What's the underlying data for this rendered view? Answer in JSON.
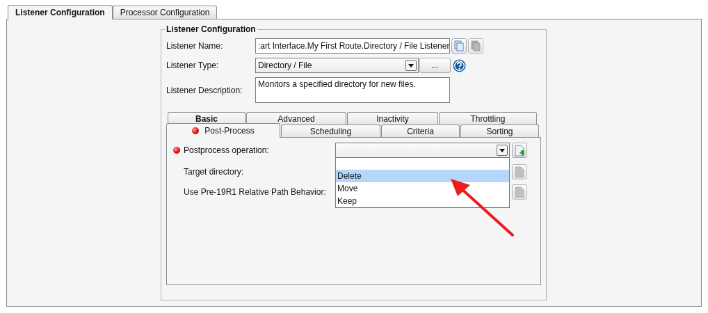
{
  "tabs": [
    {
      "label": "Listener Configuration",
      "selected": true
    },
    {
      "label": "Processor Configuration",
      "selected": false
    }
  ],
  "group": {
    "title": "Listener Configuration",
    "fields": [
      {
        "kind": "text",
        "label": "Listener Name:",
        "value": ":art Interface.My First Route.Directory / File Listener"
      },
      {
        "kind": "select",
        "label": "Listener Type:",
        "value": "Directory / File",
        "button": "..."
      },
      {
        "kind": "textarea",
        "label": "Listener Description:",
        "value": "Monitors a specified directory for new files."
      }
    ],
    "tab_rows": [
      [
        {
          "label": "Basic",
          "selected": false,
          "bold": true,
          "error": false
        },
        {
          "label": "Advanced",
          "selected": false,
          "bold": false,
          "error": false
        },
        {
          "label": "Inactivity",
          "selected": false,
          "bold": false,
          "error": false
        },
        {
          "label": "Throttling",
          "selected": false,
          "bold": false,
          "error": false
        }
      ],
      [
        {
          "label": "Post-Process",
          "selected": true,
          "bold": false,
          "error": true
        },
        {
          "label": "Scheduling",
          "selected": false,
          "bold": false,
          "error": false
        },
        {
          "label": "Criteria",
          "selected": false,
          "bold": false,
          "error": false
        },
        {
          "label": "Sorting",
          "selected": false,
          "bold": false,
          "error": false
        }
      ]
    ],
    "settings": [
      {
        "kind": "select",
        "label": "Postprocess operation:",
        "error": true,
        "disabled": false,
        "expanded": true,
        "options": [
          {
            "label": "Delete",
            "selected": true
          },
          {
            "label": "Move",
            "selected": false
          },
          {
            "label": "Keep",
            "selected": false
          }
        ]
      },
      {
        "kind": "hidden",
        "label": "Target directory:",
        "error": false,
        "disabled": true
      },
      {
        "kind": "hidden",
        "label": "Use Pre-19R1 Relative Path Behavior:",
        "error": false,
        "disabled": true
      }
    ]
  }
}
